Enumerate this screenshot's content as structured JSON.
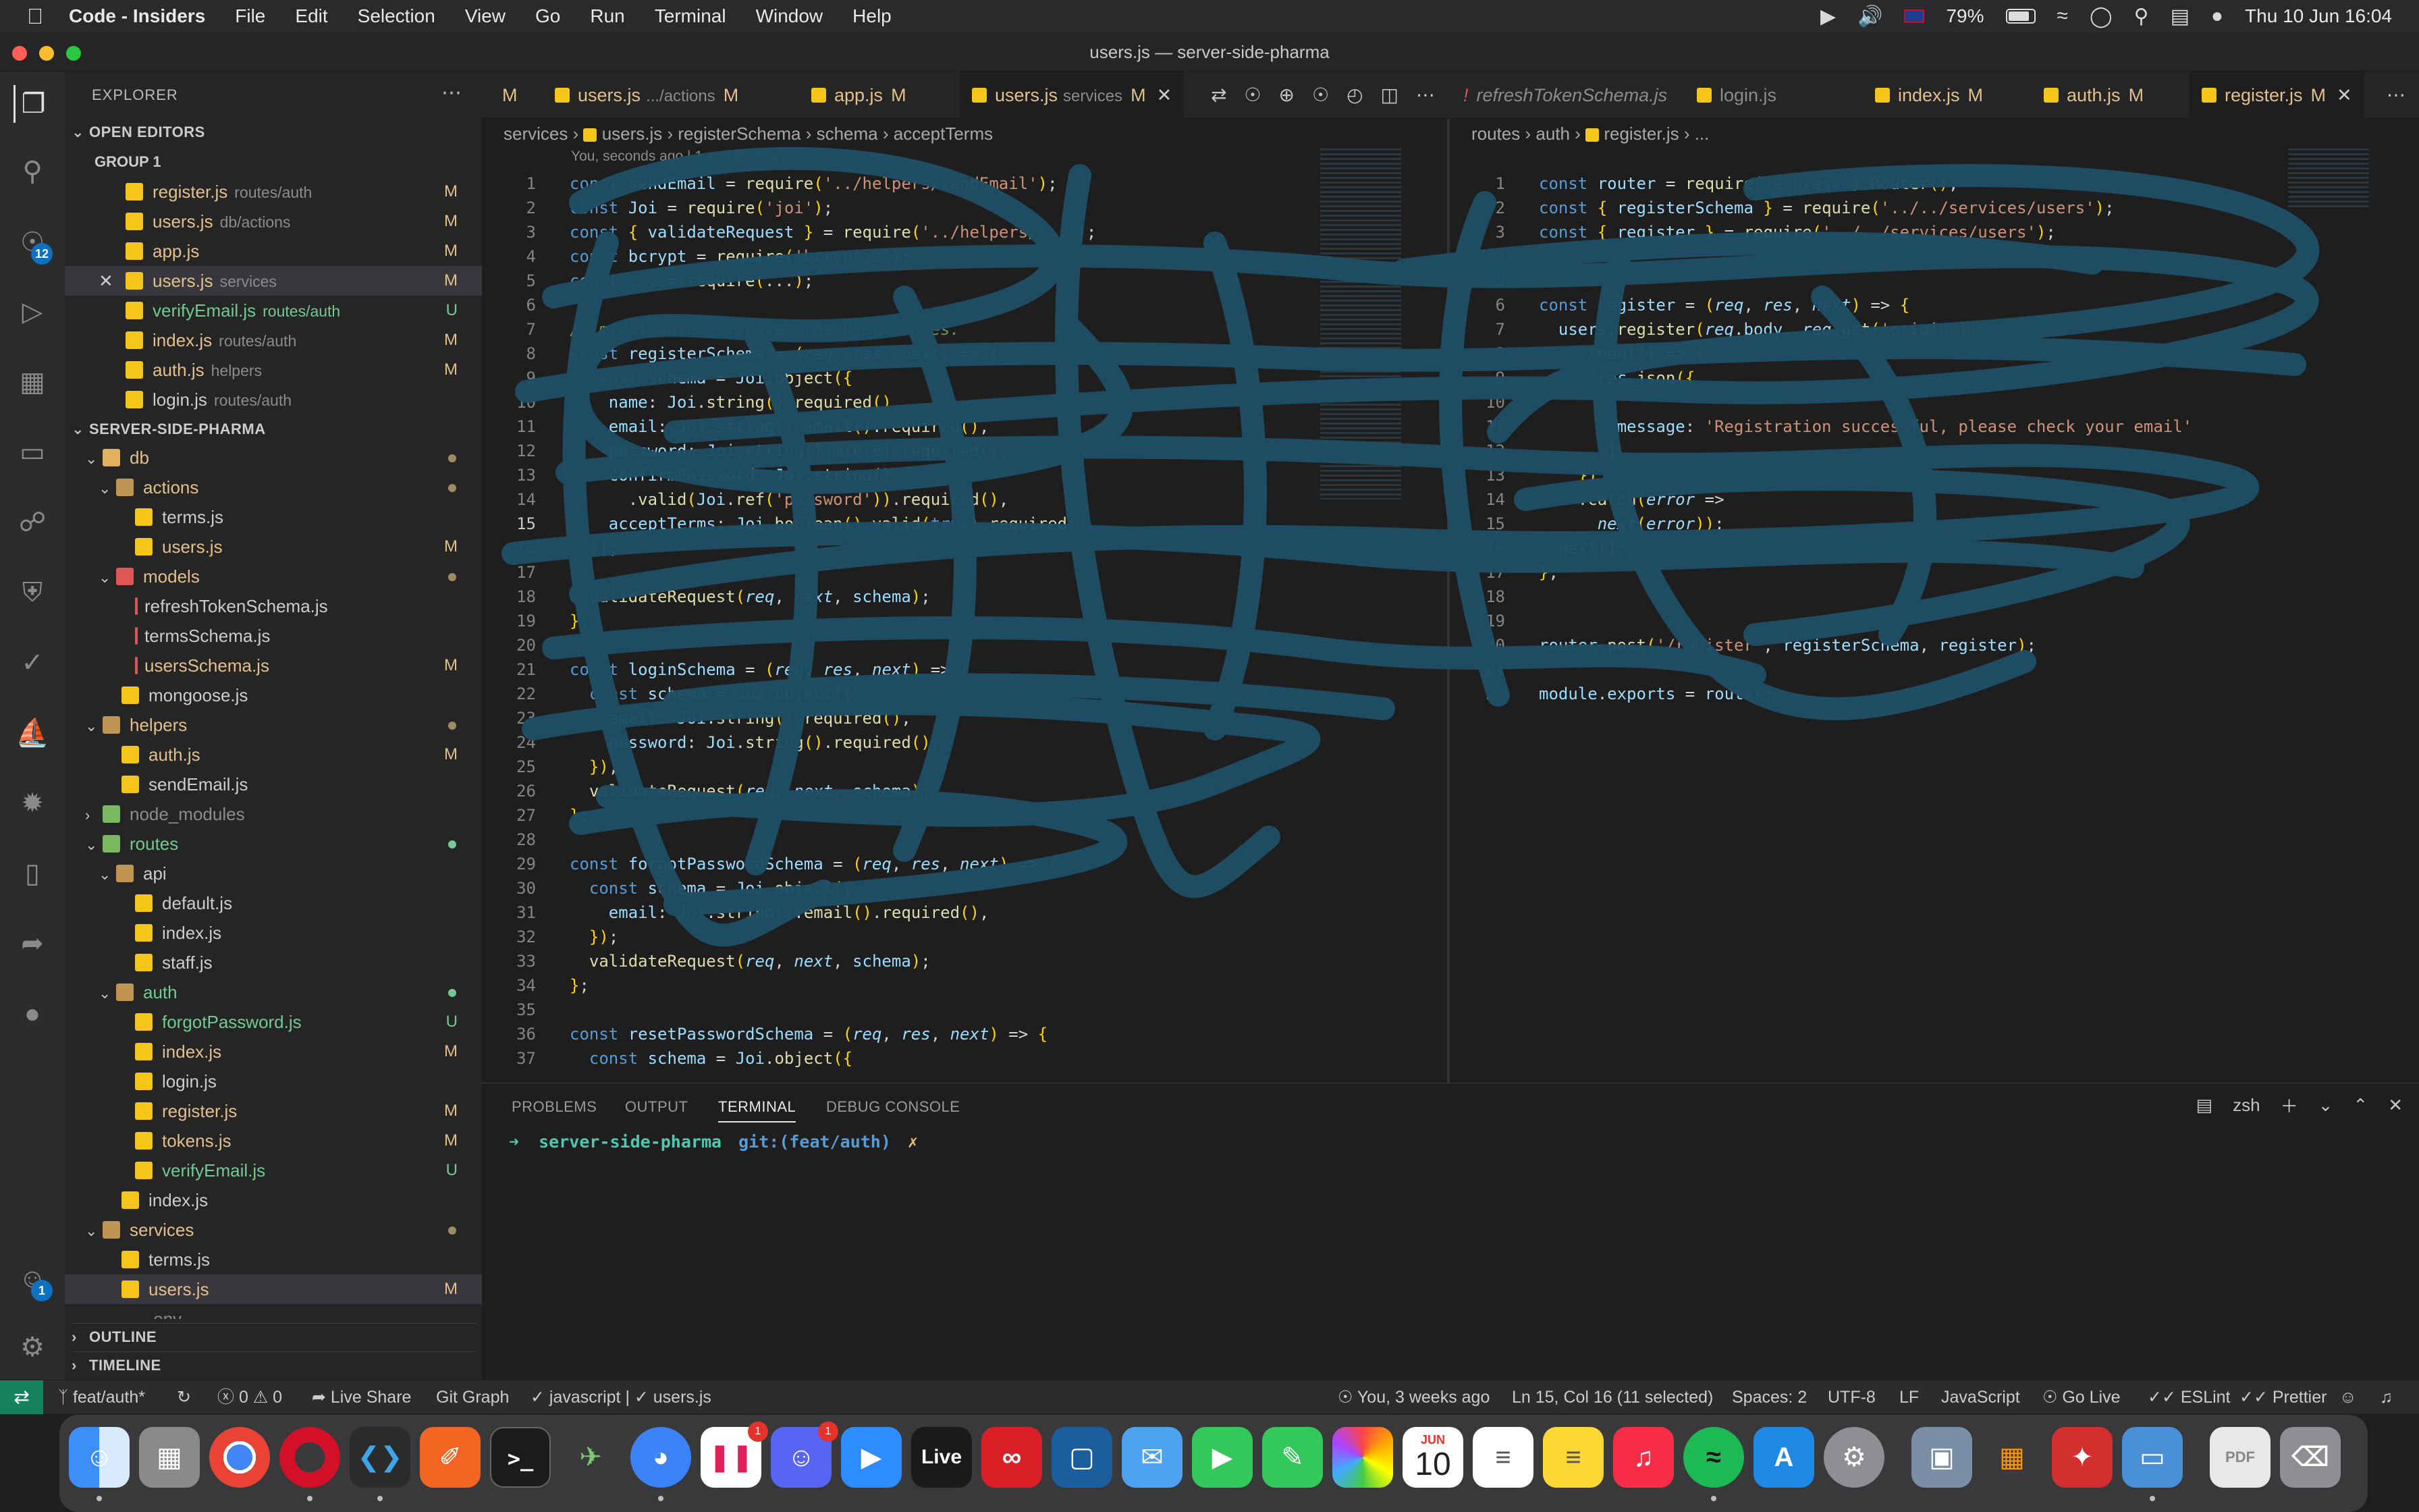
{
  "menubar": {
    "app_name": "Code - Insiders",
    "items": [
      "File",
      "Edit",
      "Selection",
      "View",
      "Go",
      "Run",
      "Terminal",
      "Window",
      "Help"
    ],
    "battery": "79%",
    "datetime": "Thu 10 Jun  16:04"
  },
  "window": {
    "title": "users.js — server-side-pharma"
  },
  "activity": {
    "scm_badge": "12",
    "account_badge": "1"
  },
  "sidebar": {
    "explorer_title": "EXPLORER",
    "open_editors_title": "OPEN EDITORS",
    "group_label": "GROUP 1",
    "open_editors": [
      {
        "name": "register.js",
        "path": "routes/auth",
        "status": "M"
      },
      {
        "name": "users.js",
        "path": "db/actions",
        "status": "M"
      },
      {
        "name": "app.js",
        "path": "",
        "status": "M"
      },
      {
        "name": "users.js",
        "path": "services",
        "status": "M"
      },
      {
        "name": "verifyEmail.js",
        "path": "routes/auth",
        "status": "U"
      },
      {
        "name": "index.js",
        "path": "routes/auth",
        "status": "M"
      },
      {
        "name": "auth.js",
        "path": "helpers",
        "status": "M"
      },
      {
        "name": "login.js",
        "path": "routes/auth",
        "status": ""
      }
    ],
    "project_title": "SERVER-SIDE-PHARMA",
    "tree": [
      {
        "label": "db",
        "status": ""
      },
      {
        "label": "actions",
        "status": ""
      },
      {
        "label": "terms.js",
        "status": ""
      },
      {
        "label": "users.js",
        "status": "M"
      },
      {
        "label": "models",
        "status": ""
      },
      {
        "label": "refreshTokenSchema.js",
        "status": ""
      },
      {
        "label": "termsSchema.js",
        "status": ""
      },
      {
        "label": "usersSchema.js",
        "status": "M"
      },
      {
        "label": "mongoose.js",
        "status": ""
      },
      {
        "label": "helpers",
        "status": ""
      },
      {
        "label": "auth.js",
        "status": "M"
      },
      {
        "label": "sendEmail.js",
        "status": ""
      },
      {
        "label": "node_modules",
        "status": ""
      },
      {
        "label": "routes",
        "status": ""
      },
      {
        "label": "api",
        "status": ""
      },
      {
        "label": "default.js",
        "status": ""
      },
      {
        "label": "index.js",
        "status": ""
      },
      {
        "label": "staff.js",
        "status": ""
      },
      {
        "label": "auth",
        "status": ""
      },
      {
        "label": "forgotPassword.js",
        "status": "U"
      },
      {
        "label": "index.js",
        "status": "M"
      },
      {
        "label": "login.js",
        "status": ""
      },
      {
        "label": "register.js",
        "status": "M"
      },
      {
        "label": "tokens.js",
        "status": "M"
      },
      {
        "label": "verifyEmail.js",
        "status": "U"
      },
      {
        "label": "index.js",
        "status": ""
      },
      {
        "label": "services",
        "status": ""
      },
      {
        "label": "terms.js",
        "status": ""
      },
      {
        "label": "users.js",
        "status": "M"
      },
      {
        "label": ".env",
        "status": ""
      }
    ],
    "outline_title": "OUTLINE",
    "timeline_title": "TIMELINE"
  },
  "editor1": {
    "tabs": [
      {
        "name": "",
        "path": "",
        "status": "M"
      },
      {
        "name": "users.js",
        "path": ".../actions",
        "status": "M"
      },
      {
        "name": "app.js",
        "path": "",
        "status": "M"
      },
      {
        "name": "users.js",
        "path": "services",
        "status": "M"
      }
    ],
    "breadcrumb": [
      "services",
      "users.js",
      "registerSchema",
      "schema",
      "acceptTerms"
    ],
    "blame": "You, seconds ago | 1 author (You)",
    "lines": [
      {
        "n": "1",
        "code": "const sendEmail = require('../helpers/sendEmail');"
      },
      {
        "n": "2",
        "code": "const Joi = require('joi');"
      },
      {
        "n": "3",
        "code": "const { validateRequest } = require('../helpers/...');"
      },
      {
        "n": "4",
        "code": "const bcrypt = require('bcryptjs');"
      },
      {
        "n": "5",
        "code": "const ... = require(...);"
      },
      {
        "n": "6",
        "code": ""
      },
      {
        "n": "7",
        "code": "// middleware validates the user routes."
      },
      {
        "n": "8",
        "code": "const registerSchema = (req, res, next) => {"
      },
      {
        "n": "9",
        "code": "  const schema = Joi.object({"
      },
      {
        "n": "10",
        "code": "    name: Joi.string().required(),"
      },
      {
        "n": "11",
        "code": "    email: Joi.string().email().required(),"
      },
      {
        "n": "12",
        "code": "    password: Joi.string().min(6).required(),"
      },
      {
        "n": "13",
        "code": "    confirmPassword: Joi.string()"
      },
      {
        "n": "14",
        "code": "      .valid(Joi.ref('password')).required(),"
      },
      {
        "n": "15",
        "code": "    acceptTerms: Joi.boolean().valid(true).required(),"
      },
      {
        "n": "16",
        "code": "  });"
      },
      {
        "n": "17",
        "code": ""
      },
      {
        "n": "18",
        "code": "  validateRequest(req, next, schema);"
      },
      {
        "n": "19",
        "code": "};"
      },
      {
        "n": "20",
        "code": ""
      },
      {
        "n": "21",
        "code": "const loginSchema = (req, res, next) => {"
      },
      {
        "n": "22",
        "code": "  const schema = Joi.object({"
      },
      {
        "n": "23",
        "code": "    email: Joi.string().required(),"
      },
      {
        "n": "24",
        "code": "    password: Joi.string().required(),"
      },
      {
        "n": "25",
        "code": "  });"
      },
      {
        "n": "26",
        "code": "  validateRequest(req, next, schema);"
      },
      {
        "n": "27",
        "code": "};"
      },
      {
        "n": "28",
        "code": ""
      },
      {
        "n": "29",
        "code": "const forgotPasswordSchema = (req, res, next) => {"
      },
      {
        "n": "30",
        "code": "  const schema = Joi.object({"
      },
      {
        "n": "31",
        "code": "    email: Joi.string().email().required(),"
      },
      {
        "n": "32",
        "code": "  });"
      },
      {
        "n": "33",
        "code": "  validateRequest(req, next, schema);"
      },
      {
        "n": "34",
        "code": "};"
      },
      {
        "n": "35",
        "code": ""
      },
      {
        "n": "36",
        "code": "const resetPasswordSchema = (req, res, next) => {"
      },
      {
        "n": "37",
        "code": "  const schema = Joi.object({"
      }
    ]
  },
  "editor2": {
    "tabs": [
      {
        "name": "refreshTokenSchema.js",
        "status": ""
      },
      {
        "name": "login.js",
        "status": ""
      },
      {
        "name": "index.js",
        "status": "M"
      },
      {
        "name": "auth.js",
        "status": "M"
      },
      {
        "name": "register.js",
        "status": "M"
      }
    ],
    "breadcrumb": [
      "routes",
      "auth",
      "register.js",
      "..."
    ],
    "lines": [
      {
        "n": "1",
        "code": "const router = require('express').Router();"
      },
      {
        "n": "2",
        "code": "const { registerSchema } = require('../../services/users');"
      },
      {
        "n": "3",
        "code": "const { register } = require('../../services/users');"
      },
      {
        "n": "4",
        "code": ""
      },
      {
        "n": "5",
        "code": ""
      },
      {
        "n": "6",
        "code": "const register = (req, res, next) => {"
      },
      {
        "n": "7",
        "code": "  users.register(req.body, req.get('origin'))"
      },
      {
        "n": "8",
        "code": "    .then(() => {"
      },
      {
        "n": "9",
        "code": "      res.json({"
      },
      {
        "n": "10",
        "code": ""
      },
      {
        "n": "11",
        "code": "        message: 'Registration successful, please check your email'"
      },
      {
        "n": "12",
        "code": "      })"
      },
      {
        "n": "13",
        "code": "    })"
      },
      {
        "n": "14",
        "code": "    .catch(error =>"
      },
      {
        "n": "15",
        "code": "      next(error));"
      },
      {
        "n": "16",
        "code": "  next();"
      },
      {
        "n": "17",
        "code": "};"
      },
      {
        "n": "18",
        "code": ""
      },
      {
        "n": "19",
        "code": ""
      },
      {
        "n": "20",
        "code": "router.post('/register', registerSchema, register);"
      },
      {
        "n": "21",
        "code": ""
      },
      {
        "n": "22",
        "code": "module.exports = router;"
      }
    ]
  },
  "panel": {
    "tabs": [
      "PROBLEMS",
      "OUTPUT",
      "TERMINAL",
      "DEBUG CONSOLE"
    ],
    "shell": "zsh",
    "prompt_dir": "server-side-pharma",
    "prompt_git": "git:(feat/auth)",
    "prompt_mark": "✗"
  },
  "statusbar": {
    "branch": "feat/auth*",
    "errors": "0",
    "warnings": "0",
    "live_share": "Live Share",
    "git_graph": "Git Graph",
    "lint_lang": "javascript |",
    "lint_file": "users.js",
    "blame": "You, 3 weeks ago",
    "position": "Ln 15, Col 16 (11 selected)",
    "spaces": "Spaces: 2",
    "encoding": "UTF-8",
    "eol": "LF",
    "language": "JavaScript",
    "go_live": "Go Live",
    "eslint": "ESLint",
    "prettier": "Prettier"
  },
  "dock": {
    "calendar_month": "JUN",
    "calendar_day": "10",
    "live_label": "Live",
    "slack_badge": "1",
    "discord_badge": "1"
  },
  "colors": {
    "scribble": "#1f4f66",
    "status_remote": "#16825d",
    "modified": "#e2c08d",
    "untracked": "#73c991"
  }
}
